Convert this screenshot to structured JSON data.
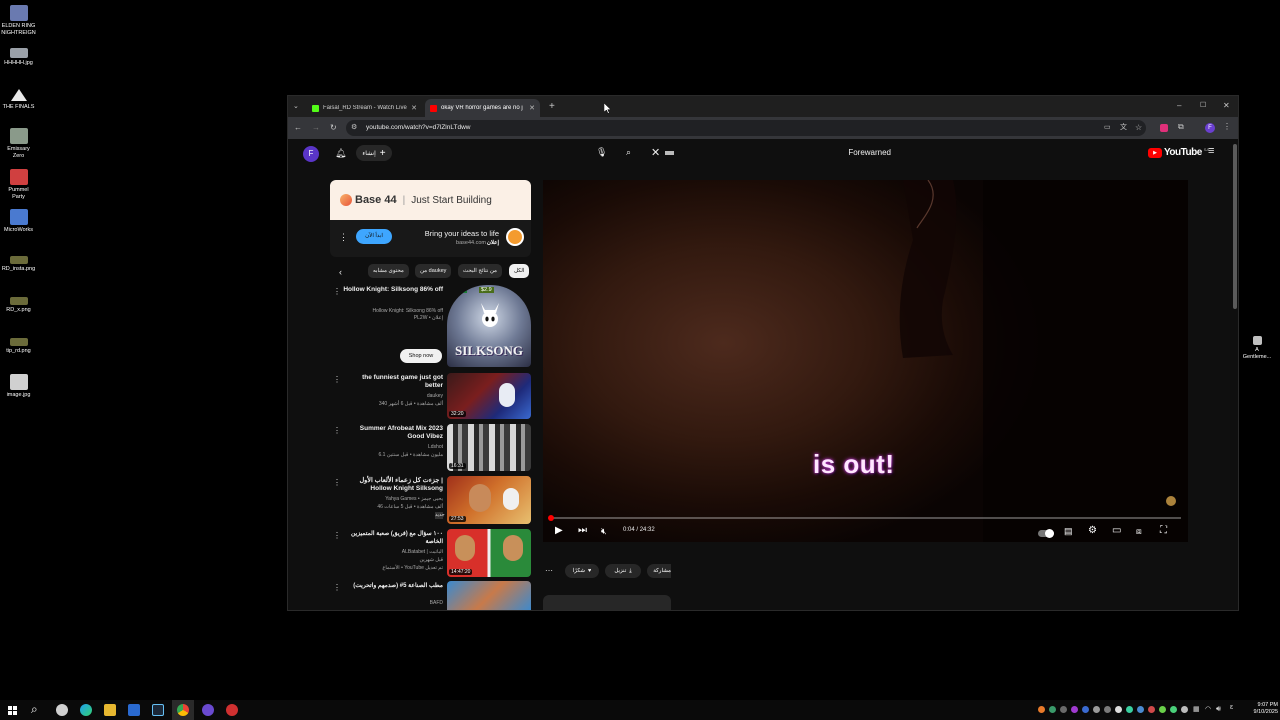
{
  "desktop": {
    "icons": [
      {
        "label": "ELDEN RING\nNIGHTREIGN",
        "color": "#6a7ab0"
      },
      {
        "label": "HHHHH.jpg",
        "color": "#9aa0a8"
      },
      {
        "label": "THE FINALS",
        "color": "#e8e8e8"
      },
      {
        "label": "Emissary\nZero",
        "color": "#8a9a8a"
      },
      {
        "label": "Pummel\nParty",
        "color": "#d04040"
      },
      {
        "label": "MicroWorks",
        "color": "#4a7ad0"
      },
      {
        "label": "RD_insta.png",
        "color": "#6b6b3a"
      },
      {
        "label": "RD_x.png",
        "color": "#6b6b3a"
      },
      {
        "label": "tip_rd.png",
        "color": "#6b6b3a"
      },
      {
        "label": "image.jpg",
        "color": "#d0d0d0"
      }
    ],
    "right_icon": {
      "label": "A\nGentleme..."
    }
  },
  "browser": {
    "tabs": [
      {
        "title": "Faisal_RD Stream - Watch Live",
        "favicon_color": "#53fc18",
        "active": false
      },
      {
        "title": "okay VR horror games are no j",
        "favicon_color": "#ff0000",
        "active": true
      }
    ],
    "url": "youtube.com/watch?v=d7lZlnLTdww",
    "profile_initial": "F"
  },
  "youtube": {
    "avatar_initial": "F",
    "create_label": "إنشاء",
    "search_query": "Forewarned",
    "logo_text": "YouTube",
    "logo_region": "SA",
    "ad": {
      "brand": "Base 44",
      "tagline": "Just Start Building",
      "headline": "Bring your ideas to life",
      "domain": "base44.com",
      "sponsored": "إعلان",
      "cta_label": "ابدأ الآن"
    },
    "chips": [
      "الكل",
      "من نتائج البحث",
      "من daukey",
      "محتوى مشابه"
    ],
    "recommendations": [
      {
        "title": "Hollow Knight: Silksong 86% off",
        "meta": "Hollow Knight: Silksong 86% off",
        "channel": "PL2W • إعلان",
        "duration": "",
        "is_ad": true,
        "badge_discount": "-86%",
        "badge_price": "$2.9",
        "cta": "Shop now",
        "thumb_text": "SILKSONG"
      },
      {
        "title": "the funniest game just got better",
        "meta": "daukey",
        "channel": "340 ألف مشاهدة • قبل 6 أشهر",
        "duration": "32:20"
      },
      {
        "title": "Summer Afrobeat Mix 2023 Good Vibez",
        "meta": "Ldshot",
        "channel": "6.1 مليون مشاهدة • قبل سنتين",
        "duration": "16:31"
      },
      {
        "title": "جزءت كل زعماء الألعاب الأول | Hollow Knight Silksong",
        "meta": "Yahya Games • يحيى جيمز",
        "channel": "46 ألف مشاهدة • قبل 5 ساعات",
        "extra": "جديد",
        "duration": "27:53"
      },
      {
        "title": "١٠٠ سؤال مع (فريق) صعبة المتميزين الخاصة",
        "meta": "ALBatabet | الباتبت",
        "channel": "قبل شهرين",
        "extra": "الأستماع • YouTube تم تعديل",
        "duration": "14:47:20"
      },
      {
        "title": "مطب الصناعة 5# (صدمهم واتحريت)",
        "meta": "BAFD",
        "channel": "",
        "duration": ""
      }
    ],
    "player": {
      "caption": "is out!",
      "time_current": "0:04",
      "time_total": "24:32",
      "progress": 0.003
    },
    "actions": {
      "share": "مشاركة",
      "download": "تنزيل",
      "clip": "شكرًا"
    }
  },
  "taskbar": {
    "time": "9:07 PM",
    "date": "9/10/2025"
  }
}
